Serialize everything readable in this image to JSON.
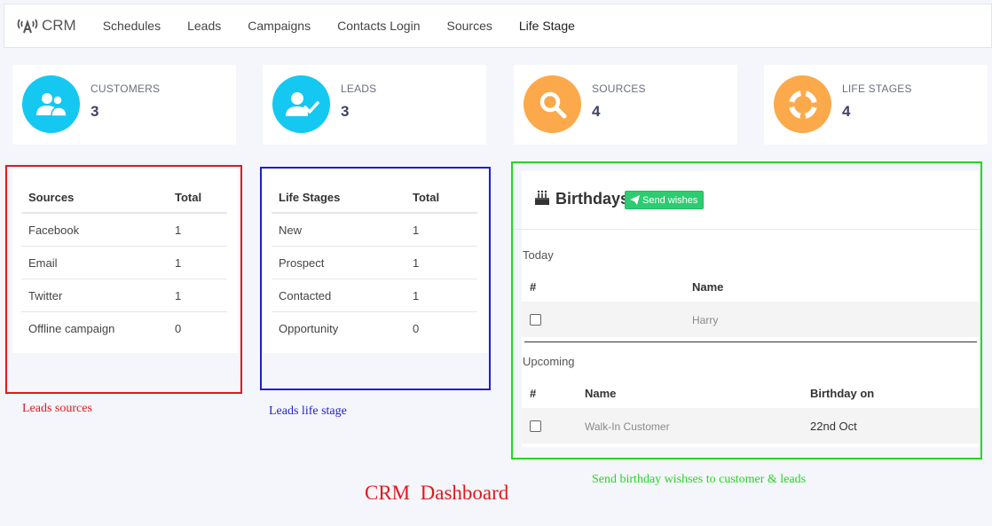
{
  "navbar": {
    "brand": "CRM",
    "items": [
      "Schedules",
      "Leads",
      "Campaigns",
      "Contacts Login",
      "Sources",
      "Life Stage"
    ]
  },
  "stats": [
    {
      "label": "CUSTOMERS",
      "value": "3",
      "icon": "users-icon",
      "color": "#14c8f1"
    },
    {
      "label": "LEADS",
      "value": "3",
      "icon": "user-check-icon",
      "color": "#14c8f1"
    },
    {
      "label": "SOURCES",
      "value": "4",
      "icon": "search-icon",
      "color": "#fba94a"
    },
    {
      "label": "LIFE STAGES",
      "value": "4",
      "icon": "lifebuoy-icon",
      "color": "#fba94a"
    }
  ],
  "sources_table": {
    "headers": [
      "Sources",
      "Total"
    ],
    "rows": [
      [
        "Facebook",
        "1"
      ],
      [
        "Email",
        "1"
      ],
      [
        "Twitter",
        "1"
      ],
      [
        "Offline campaign",
        "0"
      ]
    ]
  },
  "lifestage_table": {
    "headers": [
      "Life Stages",
      "Total"
    ],
    "rows": [
      [
        "New",
        "1"
      ],
      [
        "Prospect",
        "1"
      ],
      [
        "Contacted",
        "1"
      ],
      [
        "Opportunity",
        "0"
      ]
    ]
  },
  "birthdays": {
    "title": "Birthdays",
    "send_label": "Send wishes",
    "today_label": "Today",
    "today_headers": [
      "#",
      "Name"
    ],
    "today_rows": [
      {
        "name": "Harry"
      }
    ],
    "upcoming_label": "Upcoming",
    "upcoming_headers": [
      "#",
      "Name",
      "Birthday on"
    ],
    "upcoming_rows": [
      {
        "name": "Walk-In Customer",
        "date": "22nd Oct"
      }
    ]
  },
  "annotations": {
    "leads_sources": "Leads sources",
    "leads_life_stage": "Leads life stage",
    "birthday_note": "Send birthday wishses to customer & leads",
    "dashboard_title": "CRM  Dashboard"
  },
  "colors": {
    "red_frame": "#e0181d",
    "blue_frame": "#1f1fd0",
    "green_frame": "#21d821",
    "button_green": "#2ecc71"
  }
}
